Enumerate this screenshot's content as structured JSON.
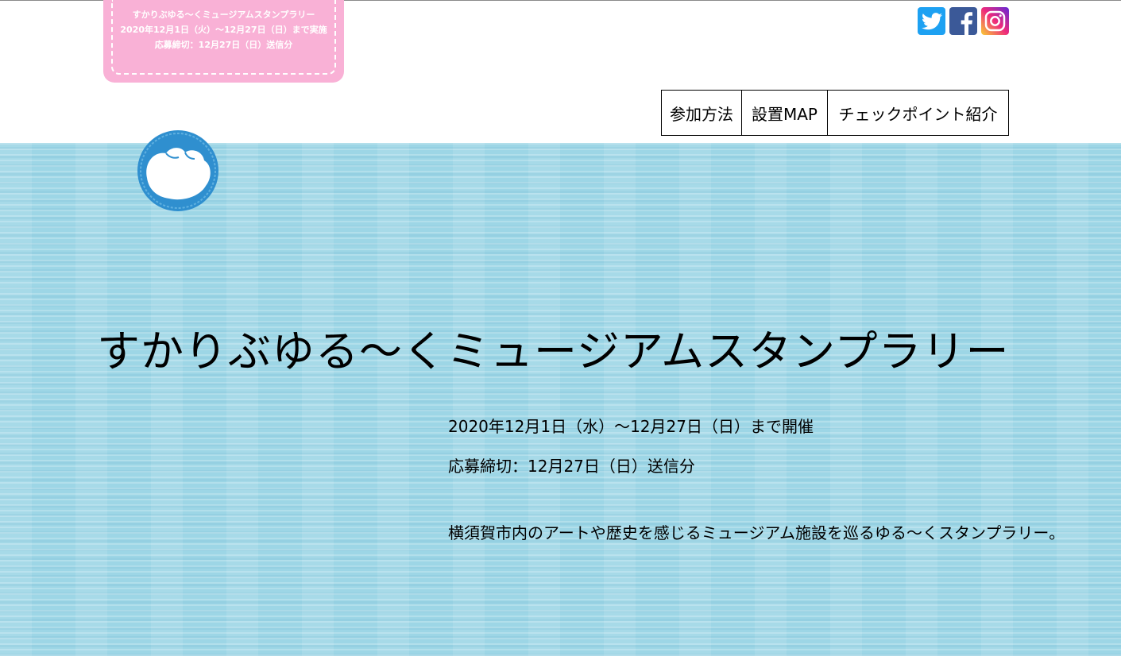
{
  "event_tag": {
    "line1": "すかりぶゆる〜くミュージアムスタンプラリー",
    "line2": "2020年12月1日（火）〜12月27日（日）まで実施",
    "line3": "応募締切：12月27日（日）送信分"
  },
  "social": [
    {
      "name": "twitter-icon",
      "color": "#1da1f2"
    },
    {
      "name": "facebook-icon",
      "color": "#3b5998"
    },
    {
      "name": "instagram-icon",
      "color": "#e1306c"
    }
  ],
  "nav": {
    "items": [
      {
        "label": "参加方法"
      },
      {
        "label": "設置MAP"
      },
      {
        "label": "チェックポイント紹介"
      }
    ]
  },
  "hero": {
    "title": "すかりぶゆる〜くミュージアムスタンプラリー",
    "dates": "2020年12月1日（水）〜12月27日（日）まで開催",
    "deadline": "応募締切：12月27日（日）送信分",
    "description": "横須賀市内のアートや歴史を感じるミュージアム施設を巡るゆる〜くスタンプラリー。"
  },
  "colors": {
    "tag_pink": "#f9b1d6",
    "water": "#9dd6e6",
    "logo_blue": "#2f8fcf"
  }
}
